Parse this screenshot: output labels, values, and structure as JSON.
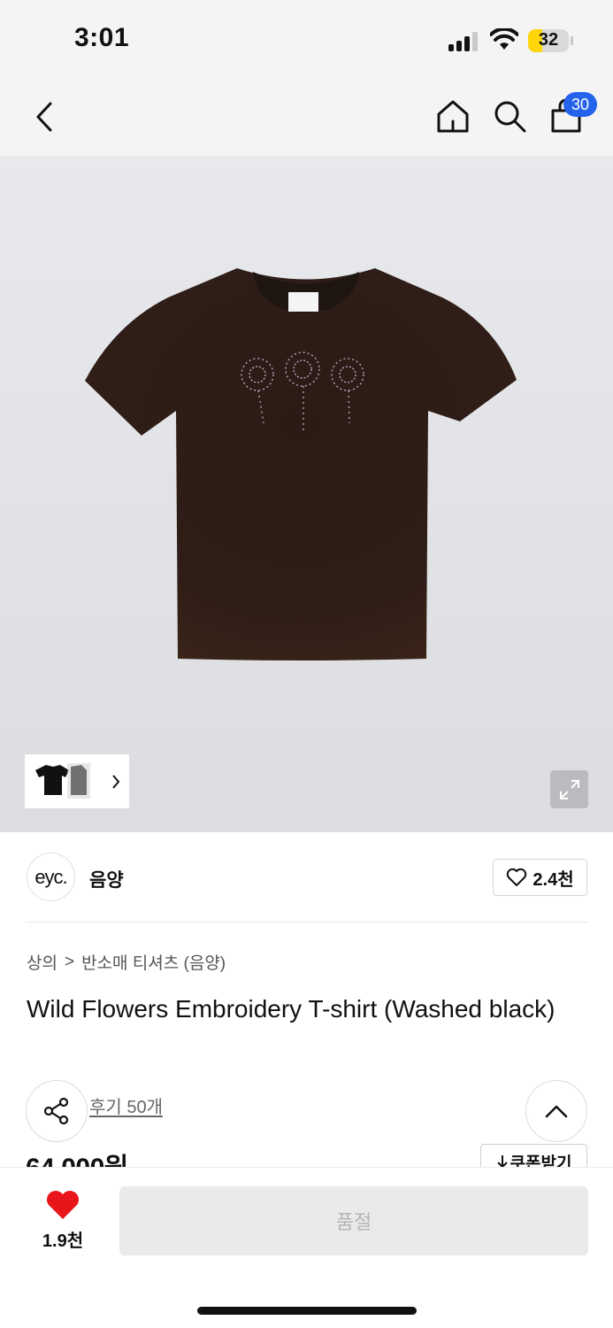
{
  "status_bar": {
    "time": "3:01",
    "battery_level": "32",
    "battery_fraction": 0.34,
    "signal_bars": 3
  },
  "nav": {
    "back_icon": "chevron-left-icon",
    "home_icon": "home-icon",
    "search_icon": "search-icon",
    "cart_icon": "shopping-bag-icon",
    "cart_count": "30",
    "badge_color": "#2563eb"
  },
  "product_image": {
    "thumbnail_count": 3,
    "expand_icon": "expand-icon"
  },
  "brand": {
    "logo_text": "eyc.",
    "name": "음양",
    "like_count": "2.4천"
  },
  "breadcrumb": {
    "category": "상의",
    "separator": ">",
    "subcategory": "반소매 티셔츠 (음양)"
  },
  "product": {
    "title": "Wild Flowers Embroidery T-shirt (Washed black)",
    "review_link": "후기 50개",
    "price": "64,000원",
    "coupon_label": "쿠폰받기"
  },
  "bottom_bar": {
    "like_count": "1.9천",
    "heart_color": "#e8161a",
    "purchase_label": "품절"
  }
}
